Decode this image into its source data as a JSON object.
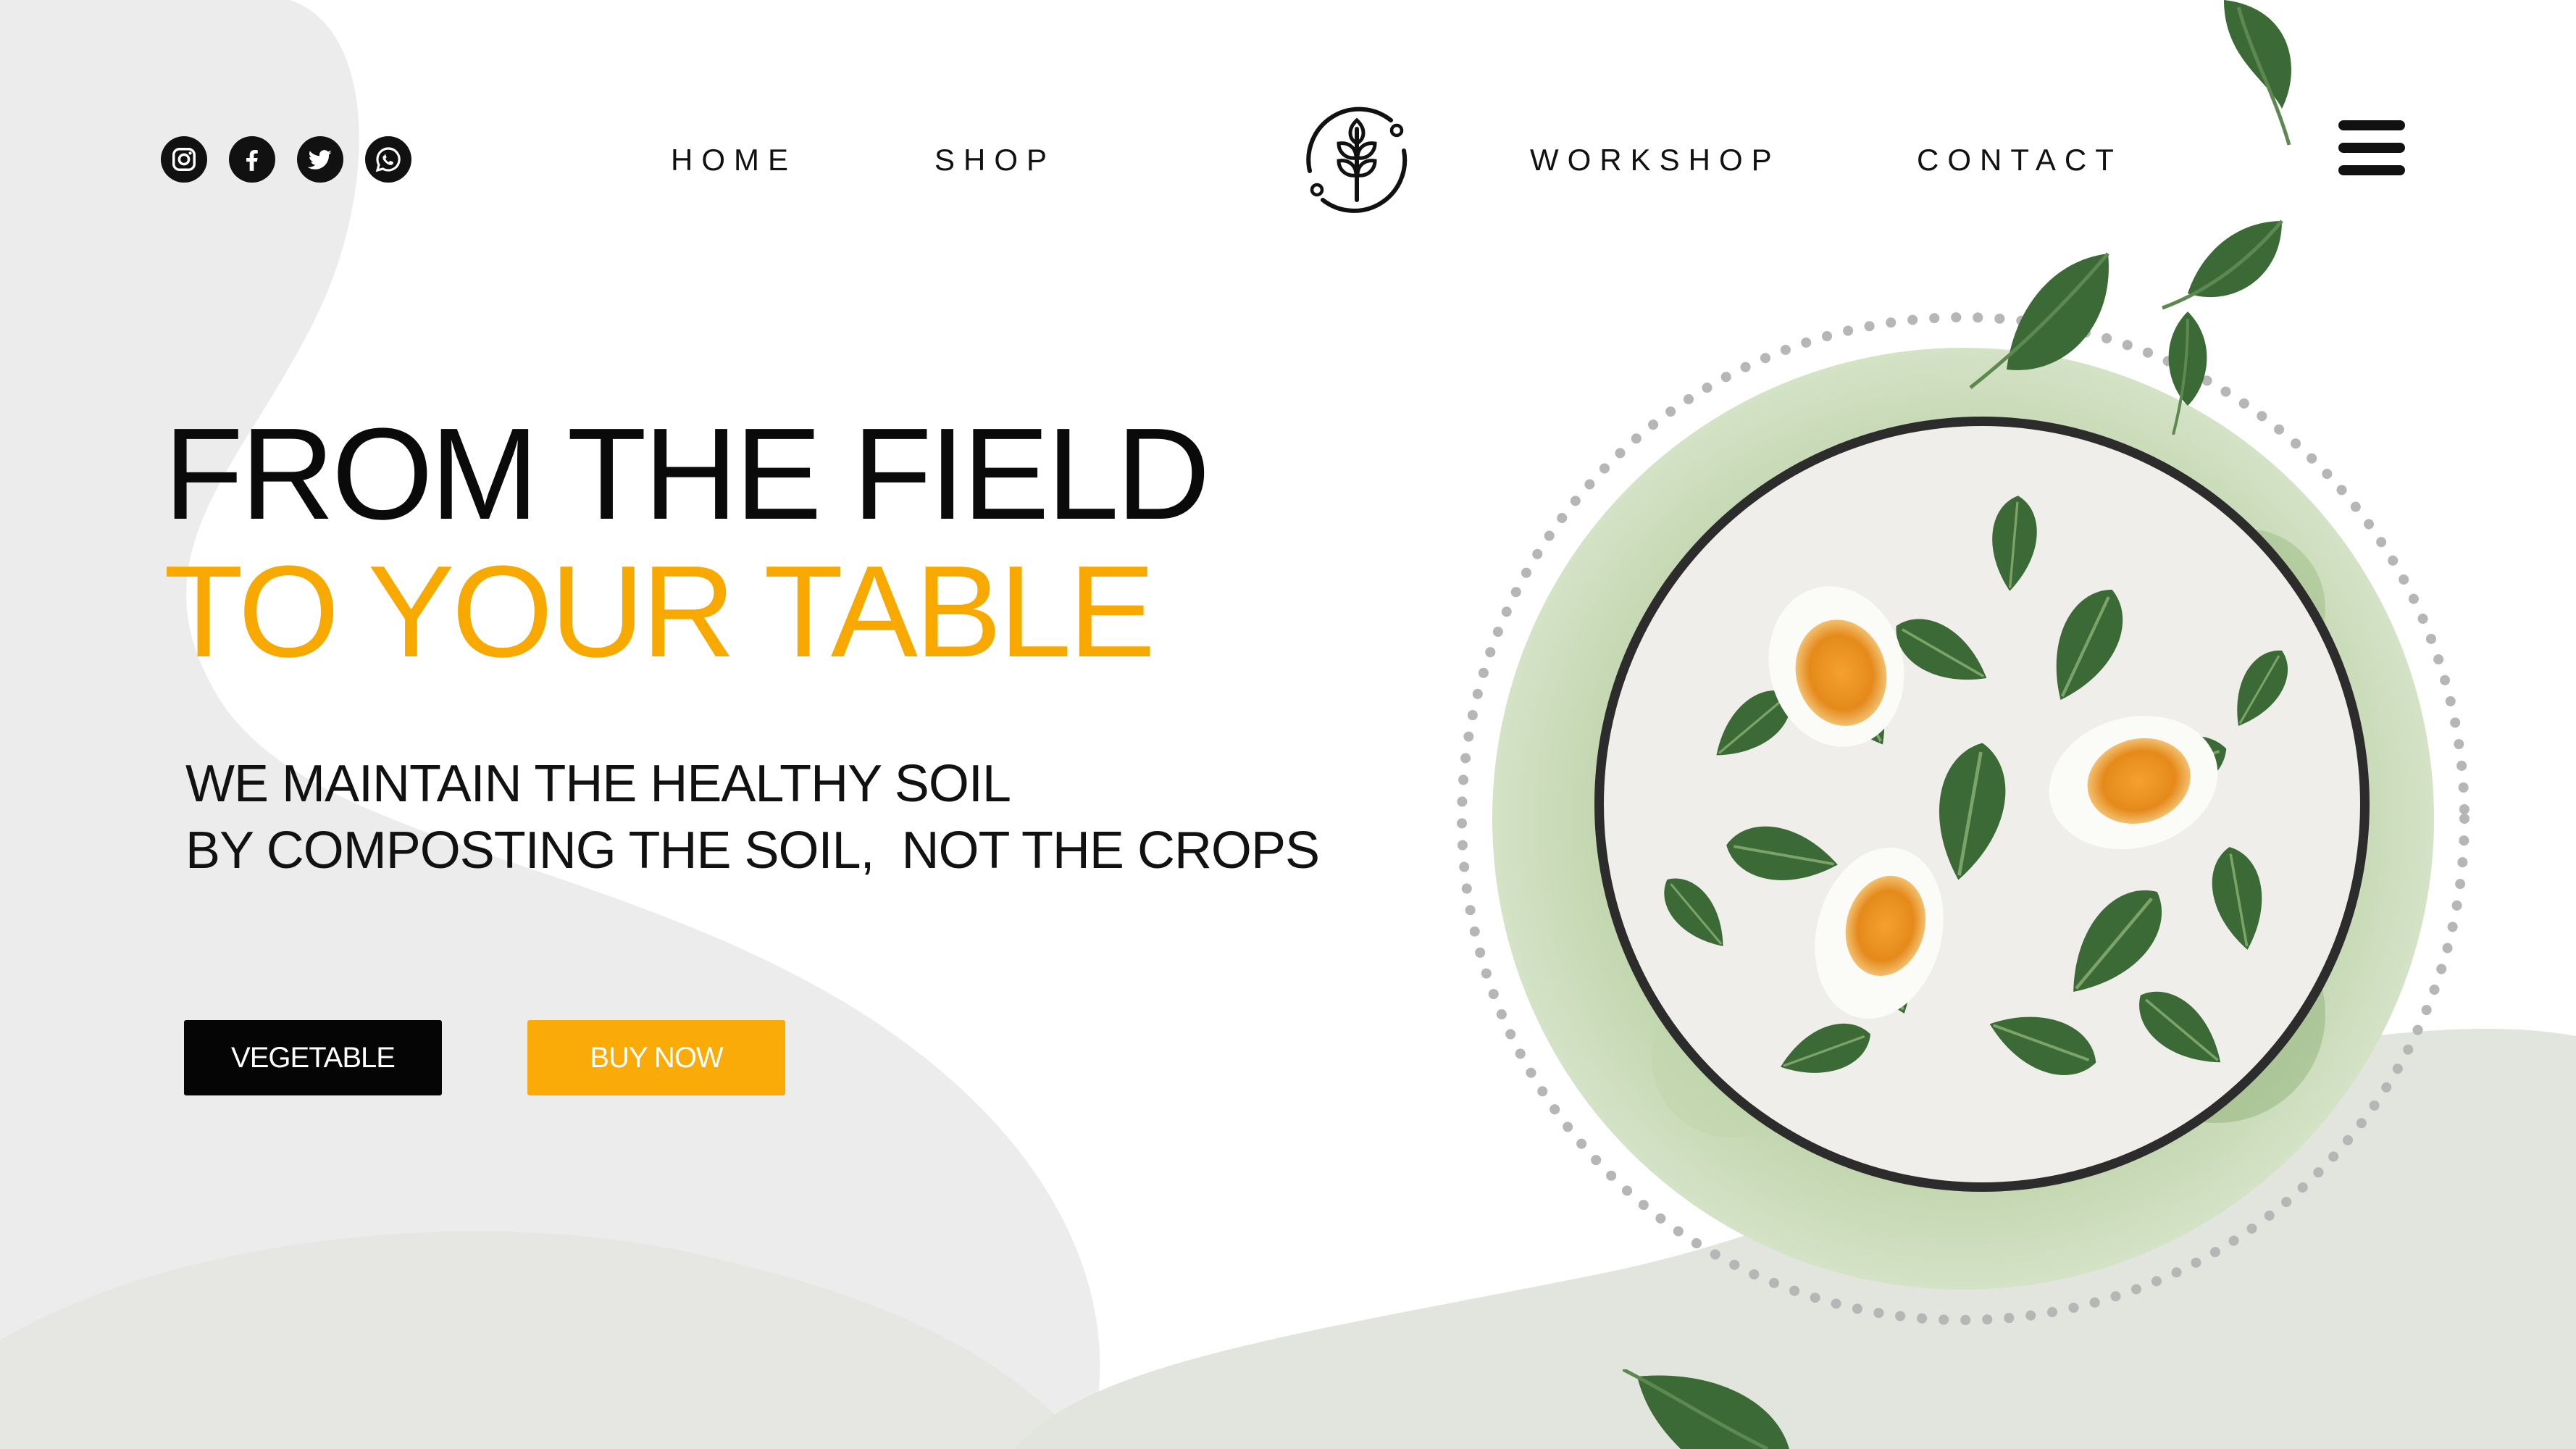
{
  "social": [
    {
      "name": "instagram-icon"
    },
    {
      "name": "facebook-icon"
    },
    {
      "name": "twitter-icon"
    },
    {
      "name": "whatsapp-icon"
    }
  ],
  "nav": {
    "home": "HOME",
    "shop": "SHOP",
    "workshop": "WORKSHOP",
    "contact": "CONTACT"
  },
  "logo": {
    "icon": "wheat-icon"
  },
  "menu": {
    "icon": "hamburger-menu-icon"
  },
  "hero": {
    "title_line1": "FROM THE FIELD",
    "title_line2": "TO YOUR TABLE",
    "tagline_line1": "WE MAINTAIN THE HEALTHY SOIL",
    "tagline_line2": "BY COMPOSTING THE SOIL,  NOT THE CROPS"
  },
  "buttons": {
    "vegetable": "VEGETABLE",
    "buy_now": "BUY NOW"
  },
  "colors": {
    "accent": "#f7a900",
    "button_dark": "#050505",
    "button_accent": "#fbab08",
    "blob": "#ececec",
    "blob_green": "#e2e5de",
    "leaf": "#3f6b3a"
  }
}
